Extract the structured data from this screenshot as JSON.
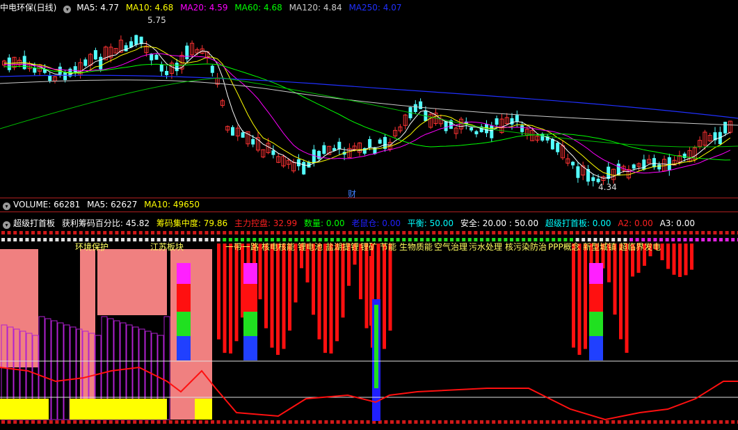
{
  "main": {
    "title": "中电环保(日线)",
    "ma": [
      {
        "label": "MA5: 4.77",
        "color": "#ffffff"
      },
      {
        "label": "MA10: 4.68",
        "color": "#ffff00"
      },
      {
        "label": "MA20: 4.59",
        "color": "#ff00ff"
      },
      {
        "label": "MA60: 4.68",
        "color": "#00ff00"
      },
      {
        "label": "MA120: 4.84",
        "color": "#cccccc"
      },
      {
        "label": "MA250: 4.07",
        "color": "#0000ff"
      }
    ],
    "high_label": "5.75",
    "low_label": "4.34",
    "marker": "财",
    "colors": {
      "up": "#ff3333",
      "down": "#54ffff"
    }
  },
  "volume": {
    "title": "VOLUME: 66281",
    "ma5": "MA5: 62627",
    "ma10": "MA10: 49650"
  },
  "indicator": {
    "title": "超级打首板",
    "items": [
      {
        "label": "获利筹码百分比: 45.82",
        "color": "#ffffff"
      },
      {
        "label": "筹码集中度: 79.86",
        "color": "#ffff00"
      },
      {
        "label": "主力控盘: 32.99",
        "color": "#ff2020"
      },
      {
        "label": "数量: 0.00",
        "color": "#00ff00"
      },
      {
        "label": "老鼠仓: 0.00",
        "color": "#2020ff"
      },
      {
        "label": "平衡: 50.00",
        "color": "#00ffff"
      },
      {
        "label": "安全: 20.00 : 50.00",
        "color": "#ffffff"
      },
      {
        "label": "超级打首板: 0.00",
        "color": "#00ffff"
      },
      {
        "label": "A2: 0.00",
        "color": "#ff2020"
      },
      {
        "label": "A3: 0.00",
        "color": "#ffffff"
      }
    ],
    "tags": [
      "环境保护",
      "江苏板块",
      "一带一路",
      "核电核能",
      "锂电池",
      "盐湖提锂",
      "锂矿",
      "节能",
      "生物质能",
      "空气治理",
      "污水处理",
      "核污染防治",
      "PPP概念",
      "新型城镇",
      "超临界发电"
    ]
  }
}
